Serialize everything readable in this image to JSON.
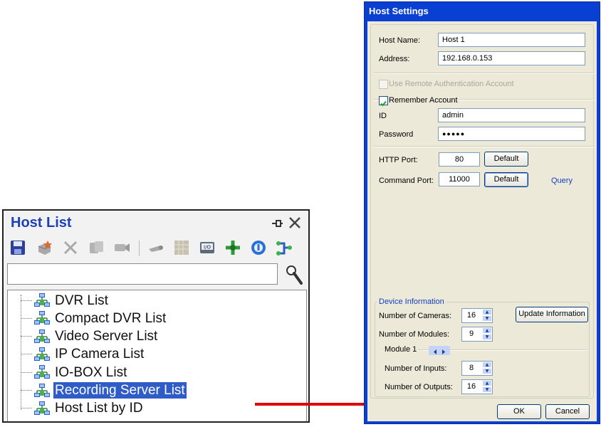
{
  "host_list": {
    "title": "Host List",
    "search": {
      "value": "",
      "placeholder": ""
    },
    "tree_items": [
      {
        "label": "DVR List",
        "selected": false
      },
      {
        "label": "Compact DVR List",
        "selected": false
      },
      {
        "label": "Video Server List",
        "selected": false
      },
      {
        "label": "IP Camera List",
        "selected": false
      },
      {
        "label": "IO-BOX List",
        "selected": false
      },
      {
        "label": "Recording Server List",
        "selected": true
      },
      {
        "label": "Host List by ID",
        "selected": false
      }
    ],
    "toolbar_icons": [
      "save-icon",
      "add-host-icon",
      "delete-icon",
      "camera-group-icon",
      "camera-icon",
      "dome-camera-icon",
      "grid-icon",
      "io-device-icon",
      "connect-icon",
      "info-icon",
      "network-icon"
    ]
  },
  "host_settings": {
    "title": "Host Settings",
    "host_name": {
      "label": "Host Name:",
      "value": "Host 1"
    },
    "address": {
      "label": "Address:",
      "value": "192.168.0.153"
    },
    "use_remote_auth": {
      "label": "Use Remote Authentication Account",
      "checked": false,
      "enabled": false
    },
    "remember_account": {
      "label": "Remember Account",
      "checked": true
    },
    "id": {
      "label": "ID",
      "value": "admin"
    },
    "password": {
      "label": "Password",
      "value": "●●●●●"
    },
    "http_port": {
      "label": "HTTP Port:",
      "value": "80",
      "default_label": "Default"
    },
    "command_port": {
      "label": "Command Port:",
      "value": "11000",
      "default_label": "Default"
    },
    "query_label": "Query",
    "device_info": {
      "title": "Device Information",
      "cameras": {
        "label": "Number of Cameras:",
        "value": "16"
      },
      "modules": {
        "label": "Number of Modules:",
        "value": "9"
      },
      "update_label": "Update Information",
      "module": {
        "label": "Module 1"
      },
      "inputs": {
        "label": "Number of Inputs:",
        "value": "8"
      },
      "outputs": {
        "label": "Number of Outputs:",
        "value": "16"
      }
    },
    "ok_label": "OK",
    "cancel_label": "Cancel"
  },
  "colors": {
    "title_blue": "#1f3fb8",
    "selection": "#2f5cc7",
    "dialog_titlebar": "#0a3fd4",
    "arrow": "#e00000"
  }
}
